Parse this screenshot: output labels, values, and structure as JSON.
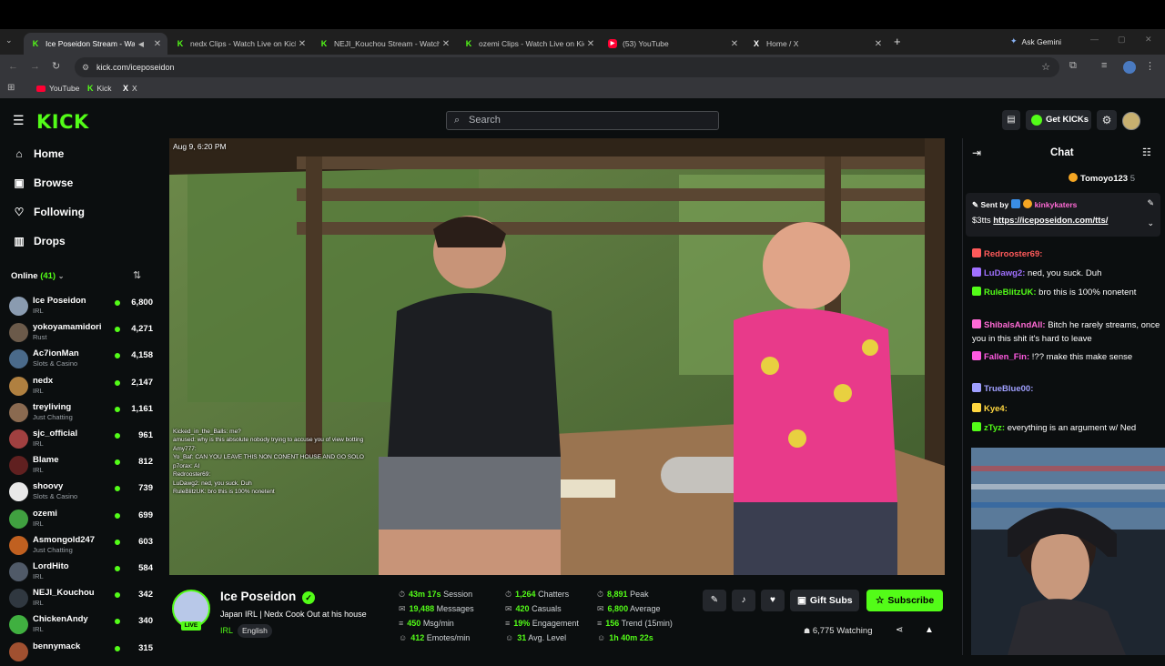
{
  "browser": {
    "tabs": [
      {
        "label": "Ice Poseidon Stream - Watc",
        "favicon": "kick-icon",
        "active": true
      },
      {
        "label": "nedx Clips - Watch Live on Kick",
        "favicon": "kick-icon"
      },
      {
        "label": "NEJI_Kouchou Stream - Watch",
        "favicon": "kick-icon"
      },
      {
        "label": "ozemi Clips - Watch Live on Kic",
        "favicon": "kick-icon"
      },
      {
        "label": "(53) YouTube",
        "favicon": "youtube-icon"
      },
      {
        "label": "Home / X",
        "favicon": "x-icon"
      }
    ],
    "ask_gemini": "Ask Gemini",
    "url": "kick.com/iceposeidon",
    "bookmarks": [
      "YouTube",
      "Kick",
      "X"
    ]
  },
  "kick": {
    "logo": "KICK",
    "search_placeholder": "Search",
    "get_kicks": "Get KICKs"
  },
  "sidebar": {
    "nav": [
      {
        "label": "Home",
        "icon": "home-icon"
      },
      {
        "label": "Browse",
        "icon": "browse-icon"
      },
      {
        "label": "Following",
        "icon": "heart-icon"
      },
      {
        "label": "Drops",
        "icon": "drops-icon"
      }
    ],
    "online_label": "Online",
    "online_count": "(41)",
    "channels": [
      {
        "name": "Ice Poseidon",
        "category": "IRL",
        "viewers": "6,800",
        "color": "#8a9bb0"
      },
      {
        "name": "yokoyamamidori",
        "category": "Rust",
        "viewers": "4,271",
        "color": "#6b5a4a"
      },
      {
        "name": "Ac7ionMan",
        "category": "Slots & Casino",
        "viewers": "4,158",
        "color": "#4a6a8a"
      },
      {
        "name": "nedx",
        "category": "IRL",
        "viewers": "2,147",
        "color": "#b08040"
      },
      {
        "name": "treyliving",
        "category": "Just Chatting",
        "viewers": "1,161",
        "color": "#8a6a50"
      },
      {
        "name": "sjc_official",
        "category": "IRL",
        "viewers": "961",
        "color": "#a04040"
      },
      {
        "name": "Blame",
        "category": "IRL",
        "viewers": "812",
        "color": "#602020"
      },
      {
        "name": "shoovy",
        "category": "Slots & Casino",
        "viewers": "739",
        "color": "#e8e8e8"
      },
      {
        "name": "ozemi",
        "category": "IRL",
        "viewers": "699",
        "color": "#40a040"
      },
      {
        "name": "Asmongold247",
        "category": "Just Chatting",
        "viewers": "603",
        "color": "#c06020"
      },
      {
        "name": "LordHito",
        "category": "IRL",
        "viewers": "584",
        "color": "#505a68"
      },
      {
        "name": "NEJI_Kouchou",
        "category": "IRL",
        "viewers": "342",
        "color": "#303840"
      },
      {
        "name": "ChickenAndy",
        "category": "IRL",
        "viewers": "340",
        "color": "#40b040"
      },
      {
        "name": "bennymack",
        "category": "",
        "viewers": "315",
        "color": "#a05030"
      }
    ]
  },
  "video": {
    "timestamp": "Aug 9, 6:20 PM",
    "overlay_chat": [
      "Kicked_in_the_Balls: me?",
      "amused: why is this absolute nobody trying to accuse you of view botting",
      "Amy777:",
      "Yo_Baf: CAN YOU LEAVE THIS NON CONENT HOUSE AND GO SOLO",
      "p7orax: AI",
      "Redrooster69:",
      "LuDawg2: ned, you suck. Duh",
      "RuleBlitzUK: bro this is 100% nonetent"
    ]
  },
  "stream": {
    "streamer": "Ice Poseidon",
    "title": "Japan IRL | Nedx Cook Out at his house",
    "category": "IRL",
    "language": "English",
    "live_badge": "LIVE",
    "stats": [
      {
        "value": "43m 17s",
        "label": "Session"
      },
      {
        "value": "19,488",
        "label": "Messages"
      },
      {
        "value": "450",
        "label": "Msg/min"
      },
      {
        "value": "412",
        "label": "Emotes/min"
      },
      {
        "value": "1,264",
        "label": "Chatters"
      },
      {
        "value": "420",
        "label": "Casuals"
      },
      {
        "value": "19%",
        "label": "Engagement"
      },
      {
        "value": "31",
        "label": "Avg. Level"
      },
      {
        "value": "8,891",
        "label": "Peak"
      },
      {
        "value": "6,800",
        "label": "Average"
      },
      {
        "value": "156",
        "label": "Trend (15min)"
      },
      {
        "value": "1h 40m 22s",
        "label": ""
      }
    ],
    "gift_subs": "Gift Subs",
    "subscribe": "Subscribe",
    "watching": "6,775 Watching"
  },
  "chat": {
    "title": "Chat",
    "top_gifter": "Tomoyo123",
    "top_gifter_count": "5",
    "pinned_sent_by": "Sent by",
    "pinned_user": "kinkykaters",
    "pinned_text": "$3tts",
    "pinned_link": "https://iceposeidon.com/tts/",
    "messages": [
      {
        "user": "Redrooster69:",
        "text": "",
        "color": "#ff5a5a"
      },
      {
        "user": "LuDawg2:",
        "text": "ned, you suck. Duh",
        "color": "#a070ff"
      },
      {
        "user": "RuleBlitzUK:",
        "text": "bro this is 100% nonetent",
        "color": "#53fc18"
      },
      {
        "user": "ShibalsAndAll:",
        "text": "Bitch he rarely streams, once you in this shit it's hard to leave",
        "color": "#ff6ad5"
      },
      {
        "user": "Fallen_Fin:",
        "text": "!?? make this make sense",
        "color": "#ff5ae0"
      },
      {
        "user": "TrueBlue00:",
        "text": "",
        "color": "#a0a0ff"
      },
      {
        "user": "Kye4:",
        "text": "",
        "color": "#ffd740"
      },
      {
        "user": "zTyz:",
        "text": "everything is an argument w/ Ned",
        "color": "#53fc18"
      }
    ]
  }
}
